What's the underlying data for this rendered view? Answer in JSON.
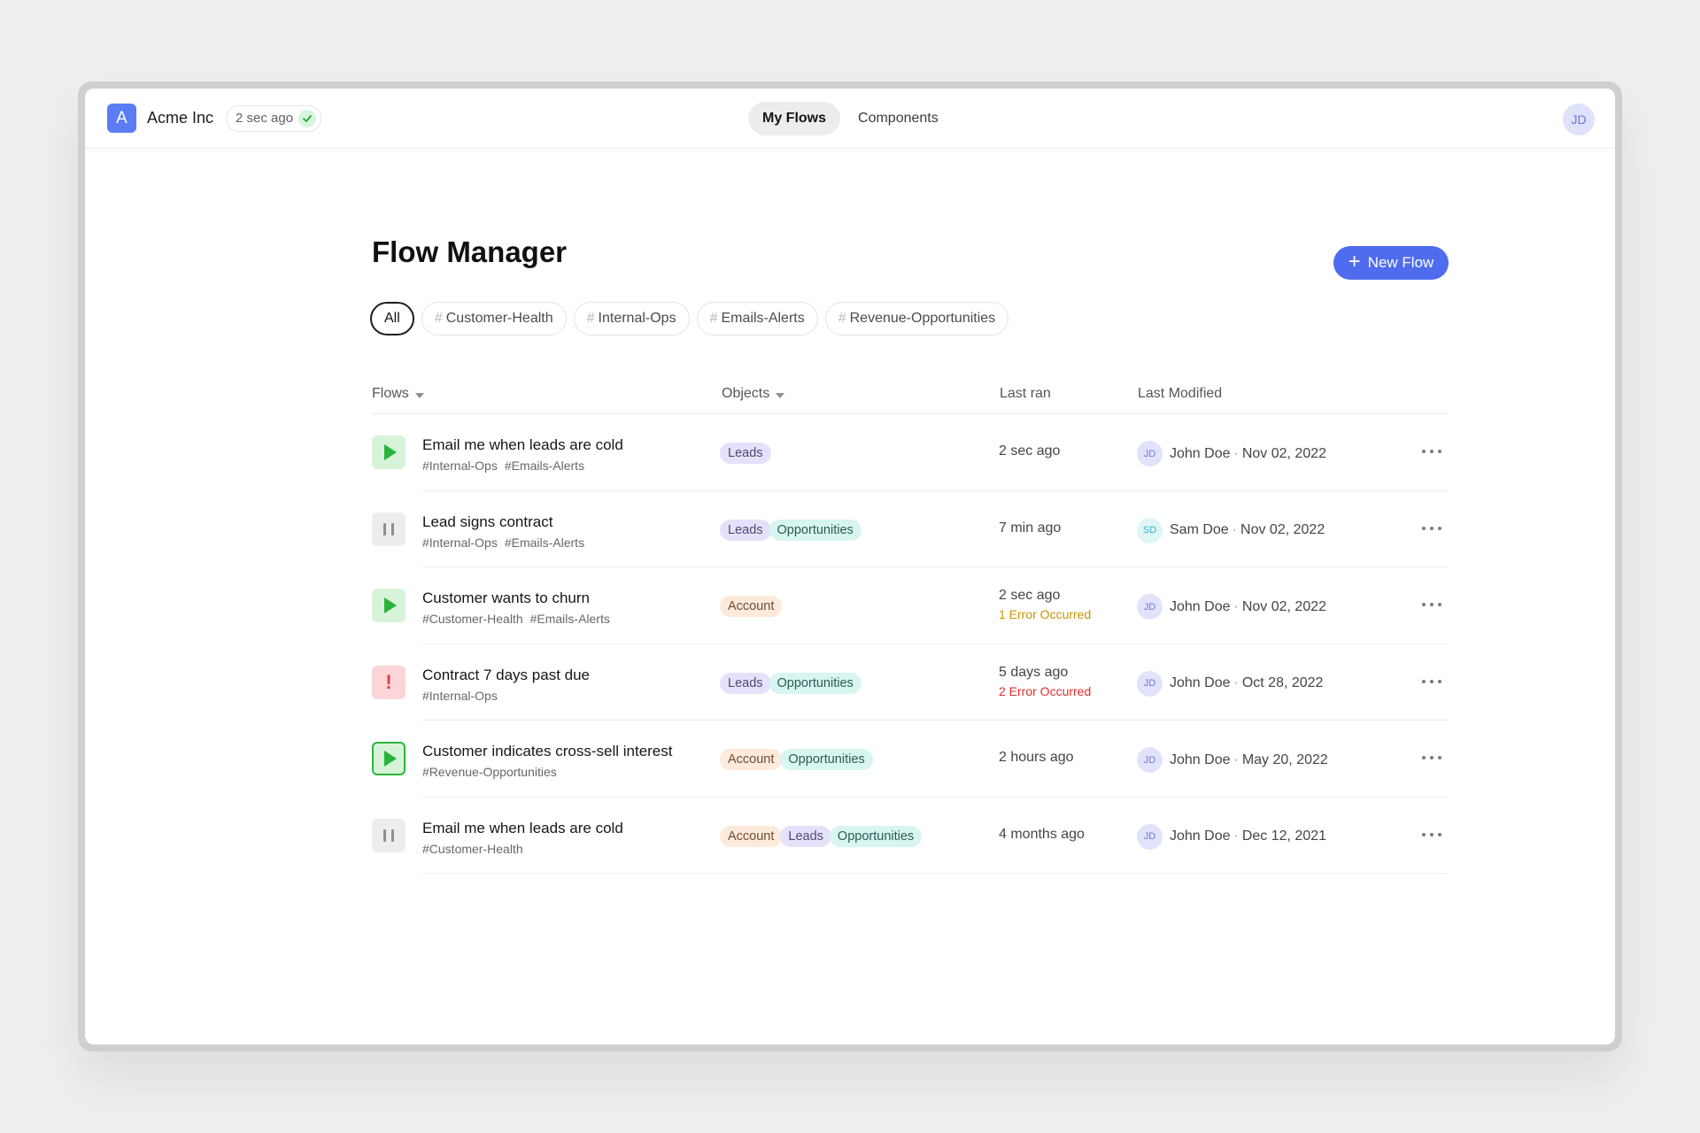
{
  "header": {
    "logo_letter": "A",
    "org_name": "Acme Inc",
    "sync_status": "2 sec ago",
    "nav": [
      {
        "label": "My Flows",
        "active": true
      },
      {
        "label": "Components",
        "active": false
      }
    ],
    "user_initials": "JD"
  },
  "page": {
    "title": "Flow Manager",
    "new_flow_label": "New Flow",
    "filters": [
      {
        "label": "All",
        "hash": false,
        "active": true
      },
      {
        "label": "Customer-Health",
        "hash": true,
        "active": false
      },
      {
        "label": "Internal-Ops",
        "hash": true,
        "active": false
      },
      {
        "label": "Emails-Alerts",
        "hash": true,
        "active": false
      },
      {
        "label": "Revenue-Opportunities",
        "hash": true,
        "active": false
      }
    ]
  },
  "table": {
    "columns": {
      "flows": "Flows",
      "objects": "Objects",
      "last_ran": "Last ran",
      "last_modified": "Last Modified"
    },
    "rows": [
      {
        "status": "running",
        "name": "Email me when leads are cold",
        "tags": [
          "#Internal-Ops",
          "#Emails-Alerts"
        ],
        "objects": [
          "Leads"
        ],
        "last_ran": "2 sec ago",
        "error": "",
        "user_initials": "JD",
        "user": "John Doe",
        "date": "Nov 02, 2022"
      },
      {
        "status": "paused",
        "name": "Lead signs contract",
        "tags": [
          "#Internal-Ops",
          "#Emails-Alerts"
        ],
        "objects": [
          "Leads",
          "Opportunities"
        ],
        "last_ran": "7 min ago",
        "error": "",
        "user_initials": "SD",
        "user": "Sam Doe",
        "date": "Nov 02, 2022"
      },
      {
        "status": "running",
        "name": "Customer wants to churn",
        "tags": [
          "#Customer-Health",
          "#Emails-Alerts"
        ],
        "objects": [
          "Account"
        ],
        "last_ran": "2 sec ago",
        "error": "1 Error Occurred",
        "error_level": "warn",
        "user_initials": "JD",
        "user": "John Doe",
        "date": "Nov 02, 2022"
      },
      {
        "status": "error",
        "name": "Contract 7 days past due",
        "tags": [
          "#Internal-Ops"
        ],
        "objects": [
          "Leads",
          "Opportunities"
        ],
        "last_ran": "5 days ago",
        "error": "2 Error Occurred",
        "error_level": "bad",
        "user_initials": "JD",
        "user": "John Doe",
        "date": "Oct 28, 2022"
      },
      {
        "status": "running-selected",
        "name": "Customer indicates cross-sell interest",
        "tags": [
          "#Revenue-Opportunities"
        ],
        "objects": [
          "Account",
          "Opportunities"
        ],
        "last_ran": "2 hours ago",
        "error": "",
        "user_initials": "JD",
        "user": "John Doe",
        "date": "May 20, 2022"
      },
      {
        "status": "paused",
        "name": "Email me when leads are cold",
        "tags": [
          "#Customer-Health"
        ],
        "objects": [
          "Account",
          "Leads",
          "Opportunities"
        ],
        "last_ran": "4 months ago",
        "error": "",
        "user_initials": "JD",
        "user": "John Doe",
        "date": "Dec 12, 2021"
      }
    ]
  },
  "colors": {
    "primary": "#4f6bee",
    "logo": "#5b7cf5",
    "running": "#29b33a",
    "error": "#e23b48",
    "warning": "#c89400"
  }
}
